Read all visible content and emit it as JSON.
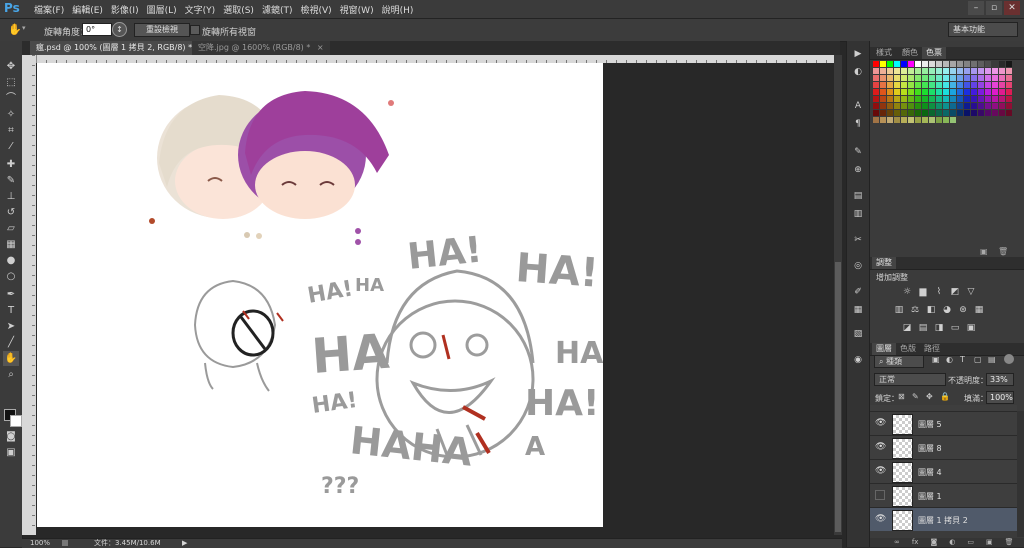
{
  "app": {
    "logo": "Ps"
  },
  "menu": [
    "檔案(F)",
    "編輯(E)",
    "影像(I)",
    "圖層(L)",
    "文字(Y)",
    "選取(S)",
    "濾鏡(T)",
    "檢視(V)",
    "視窗(W)",
    "說明(H)"
  ],
  "window_controls": {
    "minimize": "–",
    "restore": "▫",
    "close": "✕"
  },
  "options": {
    "rotate_label": "旋轉角度：",
    "rotate_value": "0°",
    "reset_view": "重設檢視",
    "rotate_all_label": "旋轉所有視窗",
    "workspace": "基本功能"
  },
  "tabs": [
    {
      "label": "瘋.psd @ 100% (圖層 1 拷貝 2, RGB/8) *",
      "close": "×"
    },
    {
      "label": "空降.jpg @ 1600% (RGB/8) *",
      "close": "×"
    }
  ],
  "status": {
    "zoom": "100%",
    "doc": "文件：3.45M/10.6M",
    "arrow": "▶"
  },
  "canvas_text": {
    "ha_top": "HA!",
    "ha_top2": "HA!",
    "ha_left": "HA!",
    "ha_small": "HA",
    "ha_mid": "HA",
    "ha_right": "HA!",
    "ha_bottom": "HA!",
    "ha_lower": "HAHA",
    "ha_lower_right": "HA!",
    "ha_a": "A",
    "qmarks": "???"
  },
  "swatch_panel": {
    "tabs": [
      "樣式",
      "顏色",
      "色票"
    ],
    "active": 2
  },
  "adjust_panel": {
    "tab": "調整",
    "title": "增加調整"
  },
  "layers_panel": {
    "tabs": [
      "圖層",
      "色版",
      "路徑"
    ],
    "filter": "種類",
    "blend_mode": "正常",
    "opacity_label": "不透明度：",
    "opacity_value": "33%",
    "lock_label": "鎖定：",
    "fill_label": "填滿：",
    "fill_value": "100%",
    "layers": [
      {
        "name": "圖層 5",
        "visible": true,
        "selected": false
      },
      {
        "name": "圖層 8",
        "visible": true,
        "selected": false
      },
      {
        "name": "圖層 4",
        "visible": true,
        "selected": false
      },
      {
        "name": "圖層 1",
        "visible": false,
        "selected": false
      },
      {
        "name": "圖層 1 拷貝 2",
        "visible": true,
        "selected": true
      }
    ]
  },
  "colors": {
    "accent": "#49a5e6",
    "canvas": "#ffffff",
    "workspace": "#282828",
    "selected_layer": "#505a6a"
  }
}
